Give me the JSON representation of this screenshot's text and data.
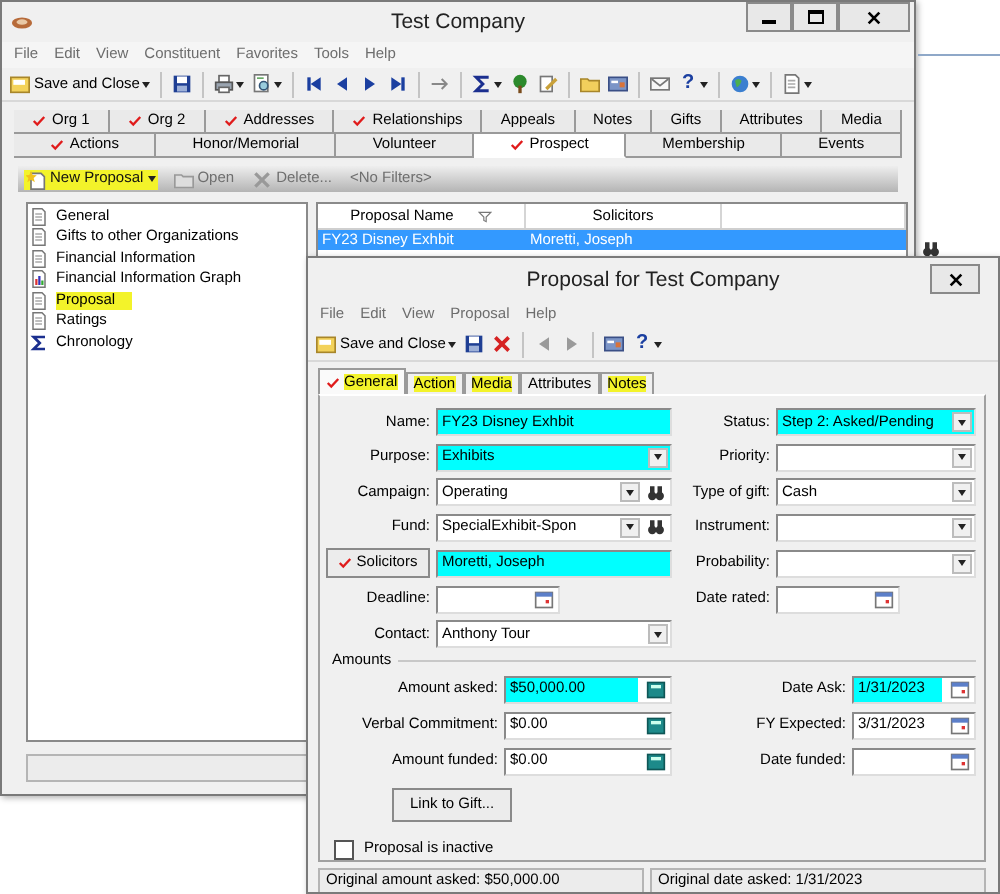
{
  "main_window": {
    "title": "Test Company",
    "menu": [
      "File",
      "Edit",
      "View",
      "Constituent",
      "Favorites",
      "Tools",
      "Help"
    ],
    "toolbar": {
      "save_label": "Save and Close",
      "help_glyph": "?"
    },
    "tabs_row1": [
      {
        "label": "Org 1",
        "checked": true,
        "selected": false
      },
      {
        "label": "Org 2",
        "checked": true,
        "selected": false
      },
      {
        "label": "Addresses",
        "checked": true,
        "selected": false
      },
      {
        "label": "Relationships",
        "checked": true,
        "selected": false
      },
      {
        "label": "Appeals",
        "checked": false,
        "selected": false
      },
      {
        "label": "Notes",
        "checked": false,
        "selected": false
      },
      {
        "label": "Gifts",
        "checked": false,
        "selected": false
      },
      {
        "label": "Attributes",
        "checked": false,
        "selected": false
      },
      {
        "label": "Media",
        "checked": false,
        "selected": false
      }
    ],
    "tabs_row2": [
      {
        "label": "Actions",
        "checked": true,
        "selected": false
      },
      {
        "label": "Honor/Memorial",
        "checked": false,
        "selected": false
      },
      {
        "label": "Volunteer",
        "checked": false,
        "selected": false
      },
      {
        "label": "Prospect",
        "checked": true,
        "selected": true
      },
      {
        "label": "Membership",
        "checked": false,
        "selected": false
      },
      {
        "label": "Events",
        "checked": false,
        "selected": false
      }
    ],
    "list_toolbar": [
      {
        "kind": "new",
        "label": "New Proposal",
        "disabled": false,
        "highlighted": true
      },
      {
        "kind": "open",
        "label": "Open",
        "disabled": true,
        "highlighted": false
      },
      {
        "kind": "delete",
        "label": "Delete...",
        "disabled": true,
        "highlighted": false
      },
      {
        "kind": "filter",
        "label": "<No Filters>",
        "disabled": true,
        "highlighted": false
      }
    ],
    "tree": [
      {
        "kind": "page",
        "label": "General",
        "highlighted": false
      },
      {
        "kind": "page",
        "label": "Gifts to other Organizations",
        "highlighted": false
      },
      {
        "kind": "page",
        "label": "Financial Information",
        "highlighted": false
      },
      {
        "kind": "graph",
        "label": "Financial Information Graph",
        "highlighted": false
      },
      {
        "kind": "page",
        "label": "Proposal",
        "highlighted": true
      },
      {
        "kind": "page",
        "label": "Ratings",
        "highlighted": false
      },
      {
        "kind": "sigma",
        "label": "Chronology",
        "highlighted": false
      }
    ],
    "grid": {
      "columns": [
        "Proposal Name",
        "Solicitors"
      ],
      "rows": [
        {
          "cells": [
            "FY23 Disney Exhbit",
            "Moretti, Joseph"
          ],
          "selected": true
        }
      ]
    }
  },
  "dialog": {
    "title": "Proposal for Test Company",
    "menu": [
      "File",
      "Edit",
      "View",
      "Proposal",
      "Help"
    ],
    "toolbar": {
      "save_label": "Save and Close",
      "help_glyph": "?"
    },
    "tabs": [
      {
        "label": "General",
        "checked": true,
        "selected": true,
        "highlighted": true
      },
      {
        "label": "Action",
        "checked": false,
        "selected": false,
        "highlighted": true
      },
      {
        "label": "Media",
        "checked": false,
        "selected": false,
        "highlighted": true
      },
      {
        "label": "Attributes",
        "checked": false,
        "selected": false,
        "highlighted": false
      },
      {
        "label": "Notes",
        "checked": false,
        "selected": false,
        "highlighted": true
      }
    ],
    "rows": [
      {
        "left": {
          "kind": "text",
          "label": "Name:",
          "value": "FY23 Disney Exhbit",
          "required": true
        },
        "right": {
          "kind": "combo",
          "label": "Status:",
          "value": "Step 2: Asked/Pending",
          "required": true
        }
      },
      {
        "left": {
          "kind": "combo",
          "label": "Purpose:",
          "value": "Exhibits",
          "required": true
        },
        "right": {
          "kind": "combo",
          "label": "Priority:",
          "required": false
        }
      },
      {
        "left": {
          "kind": "lookup",
          "label": "Campaign:",
          "value": "Operating",
          "required": false
        },
        "right": {
          "kind": "combo",
          "label": "Type of gift:",
          "value": "Cash",
          "required": false
        }
      },
      {
        "left": {
          "kind": "lookup",
          "label": "Fund:",
          "value": "SpecialExhibit-Spon",
          "required": false
        },
        "right": {
          "kind": "combo",
          "label": "Instrument:",
          "required": false
        }
      },
      {
        "left": {
          "kind": "button",
          "label": "Solicitors",
          "checked": true,
          "value": "Moretti, Joseph",
          "required": true
        },
        "right": {
          "kind": "combo",
          "label": "Probability:",
          "required": false
        }
      },
      {
        "left": {
          "kind": "date",
          "label": "Deadline:",
          "required": false
        },
        "right": {
          "kind": "date",
          "label": "Date rated:",
          "required": false
        }
      },
      {
        "left": {
          "kind": "combo",
          "label": "Contact:",
          "value": "Anthony Tour",
          "required": false
        }
      }
    ],
    "amounts": {
      "heading": "Amounts",
      "rows": [
        {
          "left": {
            "kind": "currency",
            "label": "Amount asked:",
            "value": "$50,000.00",
            "required": true
          },
          "right": {
            "kind": "date",
            "label": "Date Ask:",
            "value": "1/31/2023",
            "required": true
          }
        },
        {
          "left": {
            "kind": "currency",
            "label": "Verbal Commitment:",
            "value": "$0.00",
            "required": false
          },
          "right": {
            "kind": "date",
            "label": "FY Expected:",
            "value": "3/31/2023",
            "required": false
          }
        },
        {
          "left": {
            "kind": "currency",
            "label": "Amount funded:",
            "value": "$0.00",
            "required": false
          },
          "right": {
            "kind": "date",
            "label": "Date funded:",
            "required": false
          }
        }
      ]
    },
    "link_button": "Link to Gift...",
    "inactive": {
      "label": "Proposal is inactive",
      "checked": false
    },
    "status_bar": [
      "Original amount asked: $50,000.00",
      "Original date asked: 1/31/2023"
    ]
  }
}
